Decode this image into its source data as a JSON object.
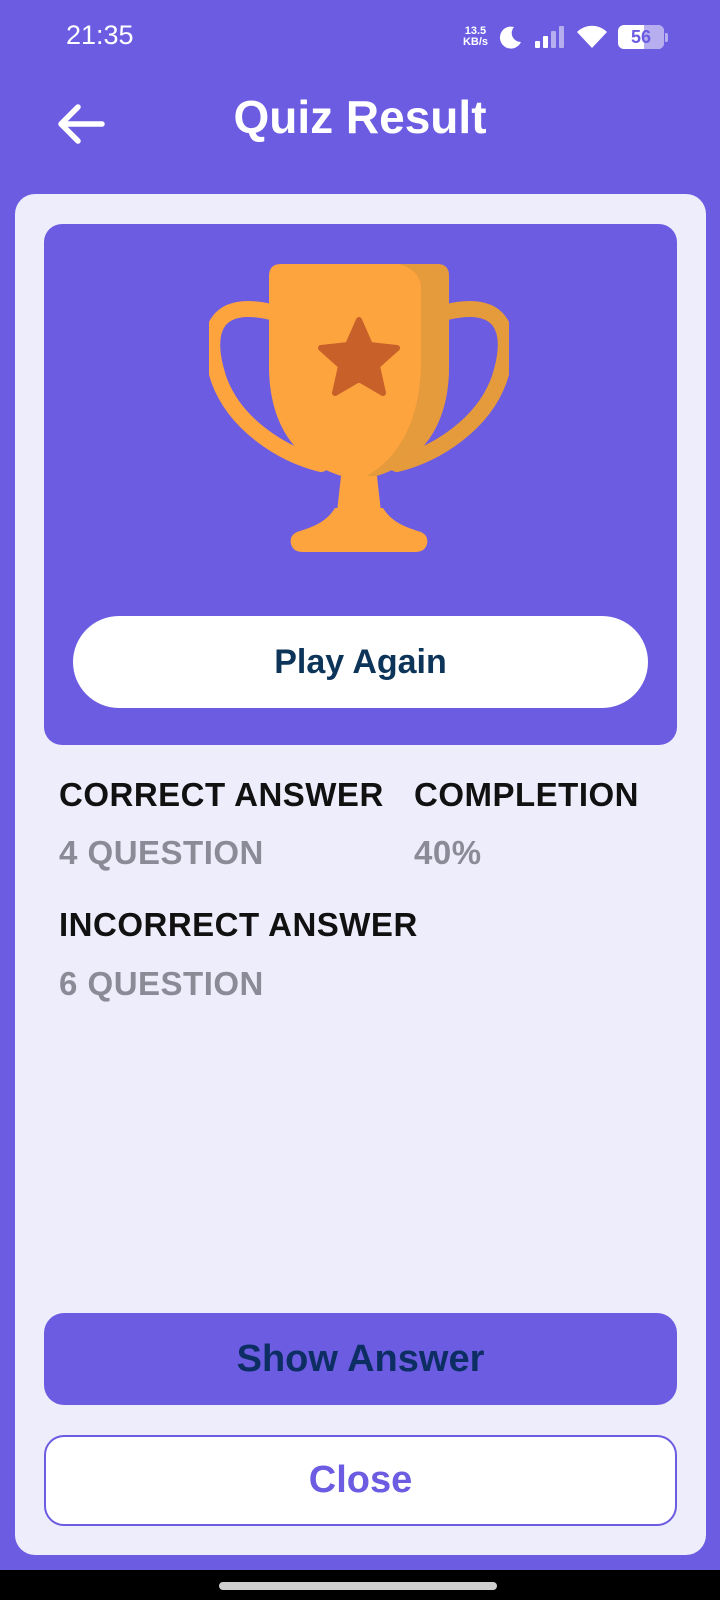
{
  "status_bar": {
    "time": "21:35",
    "net_speed_value": "13.5",
    "net_speed_unit": "KB/s",
    "battery_level": "56",
    "icons": [
      "moon-icon",
      "signal-icon",
      "wifi-icon",
      "battery-icon"
    ]
  },
  "app_bar": {
    "title": "Quiz Result",
    "back_icon": "arrow-left-icon"
  },
  "trophy": {
    "icon": "trophy-icon",
    "play_again_label": "Play Again"
  },
  "stats": {
    "correct_label": "CORRECT ANSWER",
    "correct_value": "4 QUESTION",
    "completion_label": "COMPLETION",
    "completion_value": "40%",
    "incorrect_label": "INCORRECT ANSWER",
    "incorrect_value": "6 QUESTION"
  },
  "actions": {
    "show_answer_label": "Show Answer",
    "close_label": "Close"
  },
  "colors": {
    "primary": "#6b5ce1",
    "card_background": "#eeedfb",
    "trophy_gold": "#fea43f",
    "trophy_shade": "#e59a3c",
    "star": "#c8602a",
    "play_again_text": "#0d3459",
    "muted_value": "#8a8b97"
  }
}
